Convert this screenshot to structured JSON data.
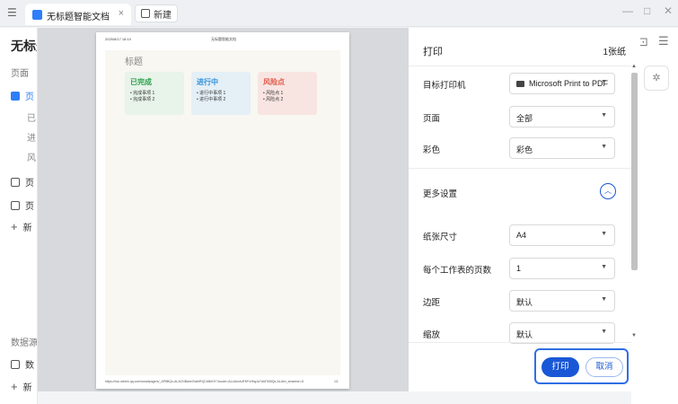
{
  "tabbar": {
    "menu_icon": "sidebar-toggle-icon",
    "tab_title": "无标题智能文档",
    "tab_close": "×",
    "new_tab_label": "新建",
    "minimize": "—",
    "maximize": "□",
    "close": "✕"
  },
  "sidebar": {
    "title": "无标是",
    "pages_section": "页面",
    "page_item": "页",
    "sub_items": [
      "已",
      "进",
      "风"
    ],
    "item2": "页",
    "item3": "页",
    "new_label": "新",
    "datasource_section": "数据源",
    "ds_item": "数",
    "ds_new": "新"
  },
  "preview": {
    "header_date": "2025/8/17 18:10",
    "header_title": "无标题智能文档",
    "doc_title": "标题",
    "cards": [
      {
        "title": "已完成",
        "items": [
          "完成事项 1",
          "完成事项 2"
        ],
        "color": "#2aa04a",
        "bg": "#e8f3ea"
      },
      {
        "title": "进行中",
        "items": [
          "进行中事项 1",
          "进行中事项 2"
        ],
        "color": "#2f8fd8",
        "bg": "#e4eff6"
      },
      {
        "title": "风险点",
        "items": [
          "风险点 1",
          "风险点 2"
        ],
        "color": "#e25a4a",
        "bg": "#f8e5e2"
      }
    ],
    "footer_url": "https://doc.weixin.qq.com/smartpage/s/_AP8BQs-ALACNBaeeGwthRQCk6bKlY?scode=ALUAmAdFKFcHhgJa?AMTABQs-ALAbx_smartnd=1t",
    "footer_page": "1/1"
  },
  "print": {
    "header": "打印",
    "page_count": "1张纸",
    "rows": {
      "printer": {
        "label": "目标打印机",
        "value": "Microsoft Print to PDF"
      },
      "pages": {
        "label": "页面",
        "value": "全部"
      },
      "color": {
        "label": "彩色",
        "value": "彩色"
      },
      "more": {
        "label": "更多设置"
      },
      "paper": {
        "label": "纸张尺寸",
        "value": "A4"
      },
      "per_sheet": {
        "label": "每个工作表的页数",
        "value": "1"
      },
      "margin": {
        "label": "边距",
        "value": "默认"
      },
      "scale": {
        "label": "缩放",
        "value": "默认"
      }
    },
    "print_button": "打印",
    "cancel_button": "取消"
  }
}
